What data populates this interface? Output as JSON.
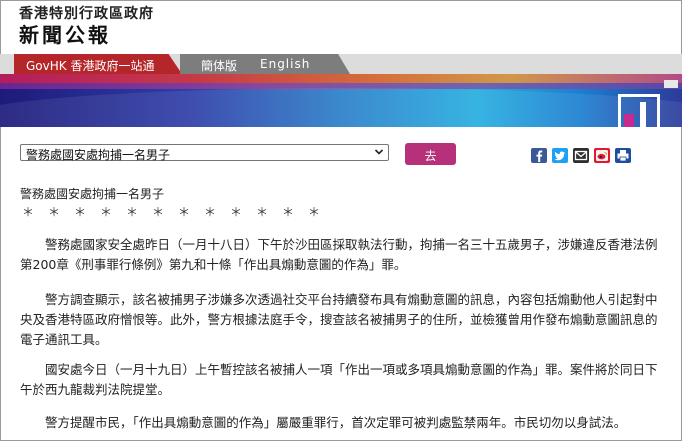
{
  "header": {
    "government": "香港特別行政區政府",
    "title": "新聞公報"
  },
  "nav": {
    "govhk": "GovHK 香港政府一站通",
    "simplified": "簡体版",
    "english": "English"
  },
  "toolbar": {
    "selected_article": "警務處國安處拘捕一名男子",
    "go_label": "去"
  },
  "share": {
    "icons": [
      "facebook-icon",
      "twitter-icon",
      "email-icon",
      "weibo-icon",
      "print-icon"
    ]
  },
  "article": {
    "headline": "警務處國安處拘捕一名男子",
    "stars": "＊　＊　＊　＊　＊　＊　＊　＊　＊　＊　＊　＊",
    "p1": [
      "　　警務處國家安全處昨日（一月十八日）下午於沙田區採取執法行動，拘捕一名三十五歲男子，涉嫌違反香港法例",
      "第200章《刑事罪行條例》第九和十條「作出具煽動意圖的作為」罪。"
    ],
    "p2": [
      "　　警方調查顯示，該名被捕男子涉嫌多次透過社交平台持續發布具有煽動意圖的訊息，內容包括煽動他人引起對中",
      "央及香港特區政府憎恨等。此外，警方根據法庭手令，搜查該名被捕男子的住所，並檢獲曾用作發布煽動意圖訊息的",
      "電子通訊工具。"
    ],
    "p3": [
      "　　國安處今日（一月十九日）上午暫控該名被捕人一項「作出一項或多項具煽動意圖的作為」罪。案件將於同日下",
      "午於西九龍裁判法院提堂。"
    ],
    "p4": [
      "　　警方提醒市民，「作出具煽動意圖的作為」屬嚴重罪行，首次定罪可被判處監禁兩年。市民切勿以身試法。"
    ]
  }
}
